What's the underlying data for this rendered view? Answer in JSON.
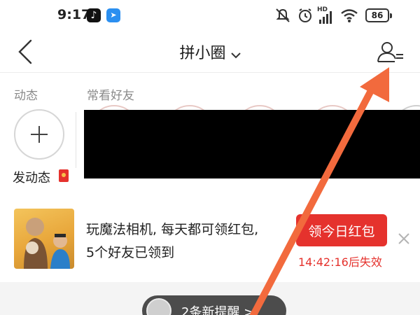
{
  "status_bar": {
    "time": "9:17",
    "tiktok_icon": "tiktok-app-icon",
    "send_icon": "send-app-icon",
    "network_label": "HD",
    "battery": "86"
  },
  "nav": {
    "title": "拼小圈",
    "back_icon": "chevron-left-icon",
    "friends_icon": "friend-list-icon"
  },
  "sections": {
    "moments_label": "动态",
    "frequent_friends_label": "常看好友"
  },
  "post": {
    "label": "发动态",
    "plus_icon": "plus-icon",
    "badge_icon": "red-packet-icon"
  },
  "promo": {
    "line1": "玩魔法相机, 每天都可领红包,",
    "line2": "5个好友已领到",
    "button": "领今日红包",
    "expire": "14:42:16后失效",
    "close_icon": "close-icon"
  },
  "reminder": {
    "text": "2条新提醒 >"
  },
  "colors": {
    "accent": "#e5322d",
    "annotation": "#f26a3d",
    "reminder_bg": "#4c4c4c",
    "band_bg": "#f4f4f4"
  }
}
